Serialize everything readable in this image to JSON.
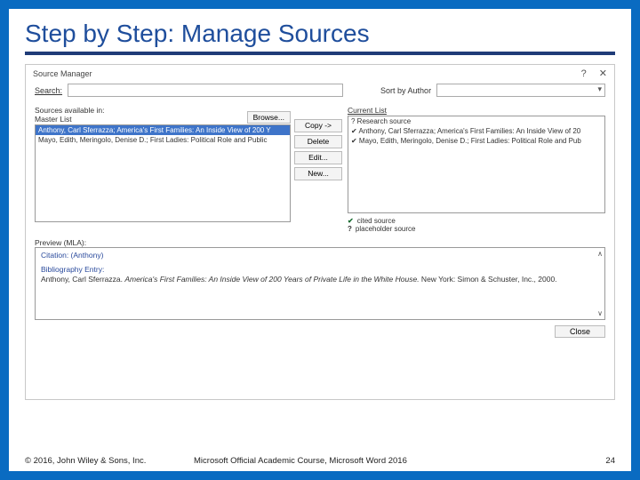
{
  "slide": {
    "title": "Step by Step: Manage Sources"
  },
  "dialog": {
    "title": "Source Manager",
    "search_label": "Search:",
    "sort_label": "Sort by Author",
    "master_list_label_line1": "Sources available in:",
    "master_list_label_line2": "Master List",
    "browse_label": "Browse...",
    "current_list_label": "Current List",
    "master_items": [
      "Anthony, Carl Sferrazza; America's First Families: An Inside View of 200 Y",
      "Mayo, Edith, Meringolo, Denise D.; First Ladies: Political Role and Public"
    ],
    "selected_master_index": 0,
    "current_items": [
      "? Research source",
      "✔ Anthony, Carl Sferrazza; America's First Families: An Inside View of 20",
      "✔ Mayo, Edith, Meringolo, Denise D.; First Ladies: Political Role and Pub"
    ],
    "buttons": {
      "copy": "Copy ->",
      "delete": "Delete",
      "edit": "Edit...",
      "new": "New..."
    },
    "legend": {
      "cited": "cited source",
      "placeholder": "placeholder source"
    },
    "preview_label": "Preview (MLA):",
    "preview": {
      "citation_label": "Citation: (Anthony)",
      "bib_label": "Bibliography Entry:",
      "bib_text_pre": "Anthony, Carl Sferrazza. ",
      "bib_text_italic": "America's First Families: An Inside View of 200 Years of Private Life in the White House.",
      "bib_text_post": " New York: Simon & Schuster, Inc., 2000."
    },
    "close_label": "Close"
  },
  "footer": {
    "left": "© 2016, John Wiley & Sons, Inc.",
    "center": "Microsoft Official Academic Course, Microsoft Word 2016",
    "right": "24"
  }
}
